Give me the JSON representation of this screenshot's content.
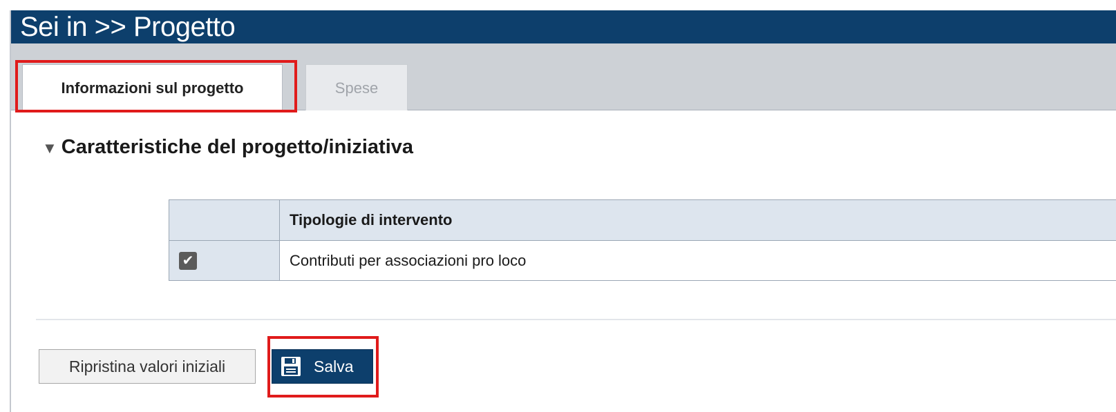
{
  "header": {
    "title": "Sei in >> Progetto"
  },
  "tabs": [
    {
      "label": "Informazioni sul progetto",
      "active": true
    },
    {
      "label": "Spese",
      "active": false
    }
  ],
  "section": {
    "title": "Caratteristiche del progetto/iniziativa",
    "toggle_icon": "triangle-down-icon"
  },
  "table": {
    "header": [
      "",
      "Tipologie di intervento"
    ],
    "rows": [
      {
        "checked": true,
        "label": "Contributi per associazioni pro loco"
      }
    ]
  },
  "actions": {
    "reset_label": "Ripristina valori iniziali",
    "save_label": "Salva",
    "save_icon": "floppy-disk-icon"
  },
  "colors": {
    "primary": "#0d3f6c",
    "highlight": "#e01b1b",
    "tab_bar": "#cdd1d6",
    "table_header": "#dde5ee"
  }
}
